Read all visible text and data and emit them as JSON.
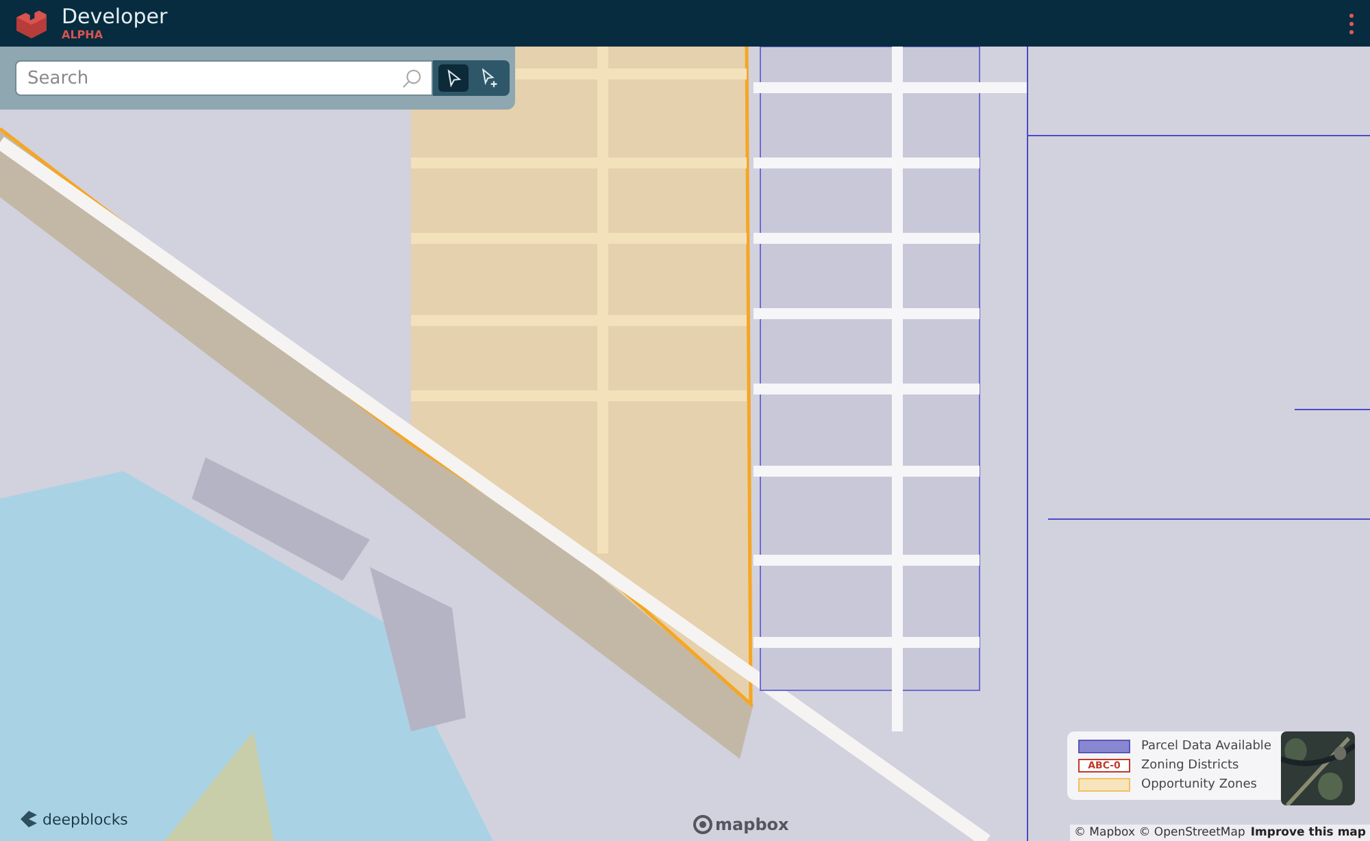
{
  "header": {
    "title": "Developer",
    "badge": "ALPHA"
  },
  "search": {
    "placeholder": "Search"
  },
  "tools": [
    {
      "kind": "select",
      "selected": true
    },
    {
      "kind": "add",
      "selected": false
    }
  ],
  "legend": [
    {
      "kind": "parcel",
      "label": "Parcel Data Available"
    },
    {
      "kind": "zoning",
      "swatch_text": "ABC-0",
      "label": "Zoning Districts"
    },
    {
      "kind": "opportunity",
      "label": "Opportunity Zones"
    }
  ],
  "brand": "deepblocks",
  "map_logo": "mapbox",
  "attribution": {
    "text": "© Mapbox © OpenStreetMap",
    "link": "Improve this map"
  }
}
